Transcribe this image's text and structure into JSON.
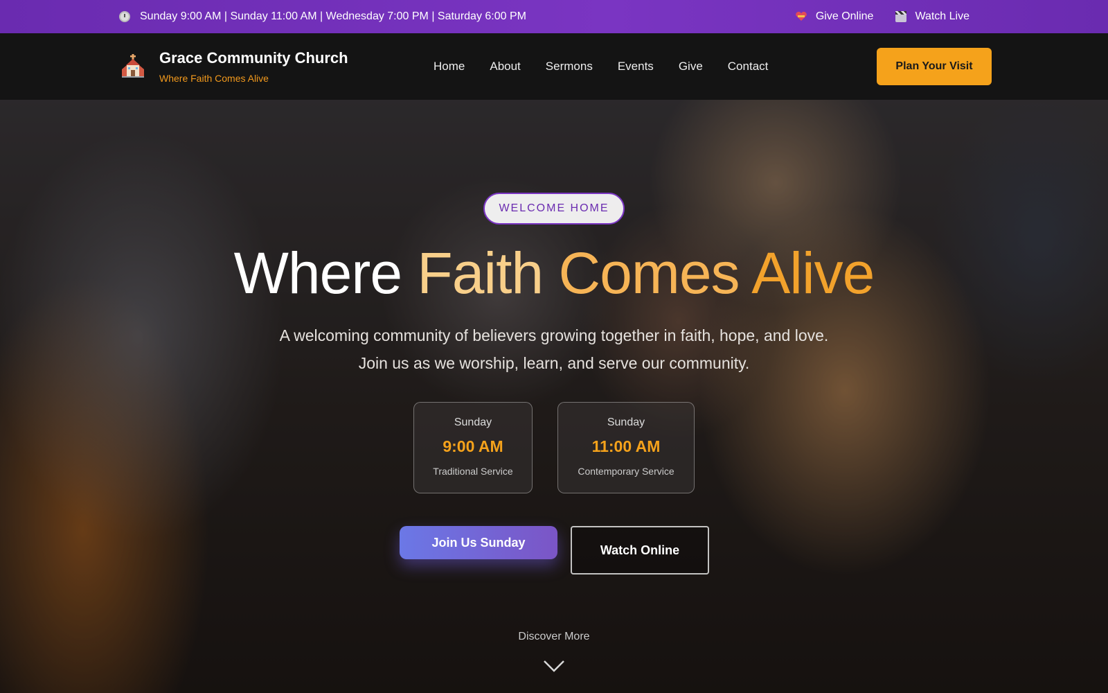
{
  "topbar": {
    "schedule": "Sunday 9:00 AM | Sunday 11:00 AM | Wednesday 7:00 PM | Saturday 6:00 PM",
    "give_online": "Give Online",
    "watch_live": "Watch Live"
  },
  "brand": {
    "name": "Grace Community Church",
    "tagline": "Where Faith Comes Alive"
  },
  "nav": {
    "items": [
      "Home",
      "About",
      "Sermons",
      "Events",
      "Give",
      "Contact"
    ],
    "cta": "Plan Your Visit"
  },
  "hero": {
    "badge": "WELCOME HOME",
    "headline": {
      "w1": "Where",
      "w2": "Faith",
      "w3": "Comes",
      "w4": "Alive"
    },
    "subtitle": "A welcoming community of believers growing together in faith, hope, and love. Join us as we worship, learn, and serve our community.",
    "services": [
      {
        "day": "Sunday",
        "time": "9:00 AM",
        "name": "Traditional Service"
      },
      {
        "day": "Sunday",
        "time": "11:00 AM",
        "name": "Contemporary Service"
      }
    ],
    "primary_cta": "Join Us Sunday",
    "secondary_cta": "Watch Online",
    "discover": "Discover More"
  },
  "colors": {
    "topbar": "#7a35c2",
    "accent": "#f5a21b",
    "navbar": "#141414"
  },
  "icons": [
    "clock-icon",
    "heart-icon",
    "clapperboard-icon",
    "church-icon",
    "chevron-down-icon"
  ]
}
